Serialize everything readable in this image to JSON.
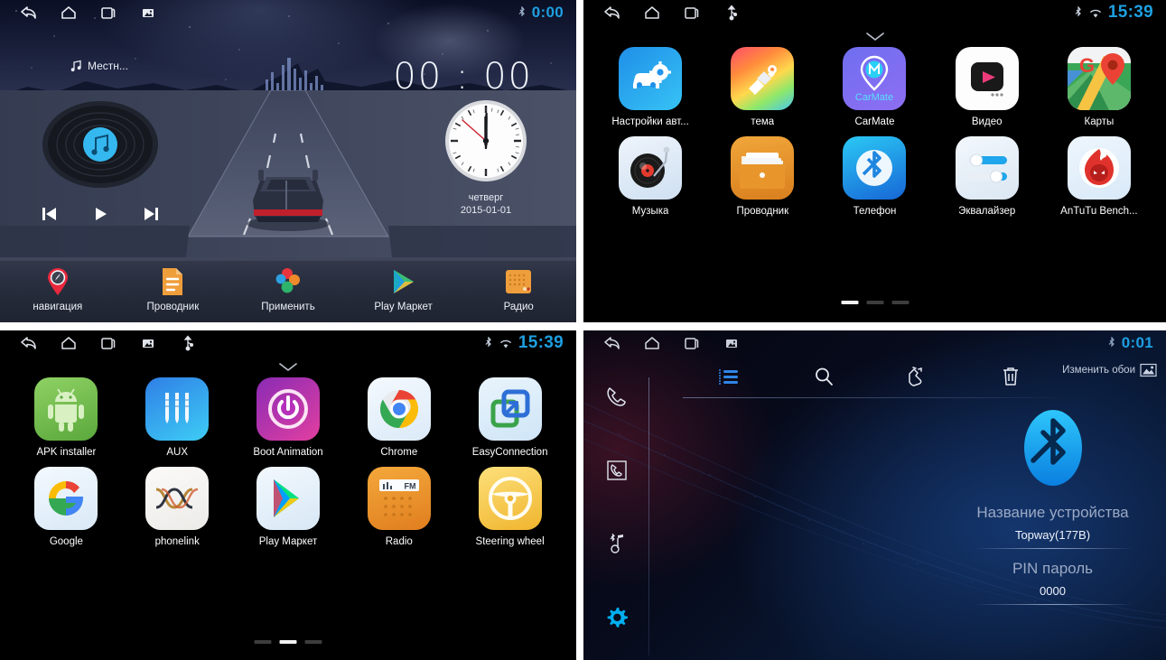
{
  "panels": {
    "home": {
      "statusbar": {
        "nav_icons": [
          "back-icon",
          "home-icon",
          "recents-icon",
          "screenshot-icon"
        ],
        "bluetooth_icon": "bluetooth-icon",
        "time": "0:00"
      },
      "now_playing": {
        "icon": "music-note-icon",
        "label": "Местн..."
      },
      "big_clock": "00 : 00",
      "media_controls": [
        "previous-track-icon",
        "play-icon",
        "next-track-icon"
      ],
      "analog_clock": {
        "day": "четверг",
        "date": "2015-01-01"
      },
      "dock": [
        {
          "label": "навигация",
          "icon": "navigation-pin-icon"
        },
        {
          "label": "Проводник",
          "icon": "file-manager-icon"
        },
        {
          "label": "Применить",
          "icon": "apply-flower-icon"
        },
        {
          "label": "Play Маркет",
          "icon": "play-store-icon"
        },
        {
          "label": "Радио",
          "icon": "radio-icon"
        }
      ]
    },
    "drawer_page1": {
      "statusbar": {
        "nav_icons": [
          "back-icon",
          "home-icon",
          "recents-icon",
          "usb-icon"
        ],
        "bluetooth_icon": "bluetooth-icon",
        "wifi_icon": "wifi-icon",
        "time": "15:39"
      },
      "pull_handle": "chevron-down-icon",
      "apps": [
        {
          "label": "Настройки авт...",
          "icon": "car-settings-icon"
        },
        {
          "label": "тема",
          "icon": "theme-brush-icon"
        },
        {
          "label": "CarMate",
          "icon": "carmate-icon"
        },
        {
          "label": "Видео",
          "icon": "video-player-icon"
        },
        {
          "label": "Карты",
          "icon": "google-maps-icon"
        },
        {
          "label": "Музыка",
          "icon": "music-turntable-icon"
        },
        {
          "label": "Проводник",
          "icon": "file-explorer-icon"
        },
        {
          "label": "Телефон",
          "icon": "bluetooth-phone-icon"
        },
        {
          "label": "Эквалайзер",
          "icon": "equalizer-icon"
        },
        {
          "label": "AnTuTu Bench...",
          "icon": "antutu-icon"
        }
      ],
      "page_dots": {
        "count": 3,
        "active": 0
      }
    },
    "drawer_page2": {
      "statusbar": {
        "nav_icons": [
          "back-icon",
          "home-icon",
          "recents-icon",
          "screenshot-icon",
          "usb-icon"
        ],
        "bluetooth_icon": "bluetooth-icon",
        "wifi_icon": "wifi-icon",
        "time": "15:39"
      },
      "pull_handle": "chevron-down-icon",
      "apps": [
        {
          "label": "APK installer",
          "icon": "android-icon"
        },
        {
          "label": "AUX",
          "icon": "aux-jack-icon"
        },
        {
          "label": "Boot Animation",
          "icon": "power-boot-icon"
        },
        {
          "label": "Chrome",
          "icon": "chrome-icon"
        },
        {
          "label": "EasyConnection",
          "icon": "easyconnection-icon"
        },
        {
          "label": "Google",
          "icon": "google-g-icon"
        },
        {
          "label": "phonelink",
          "icon": "phonelink-icon"
        },
        {
          "label": "Play Маркет",
          "icon": "play-store-icon"
        },
        {
          "label": "Radio",
          "icon": "fm-radio-icon"
        },
        {
          "label": "Steering wheel",
          "icon": "steering-wheel-icon"
        }
      ],
      "page_dots": {
        "count": 3,
        "active": 1
      }
    },
    "bluetooth": {
      "statusbar": {
        "nav_icons": [
          "back-icon",
          "home-icon",
          "recents-icon",
          "screenshot-icon"
        ],
        "bluetooth_icon": "bluetooth-icon",
        "time": "0:01"
      },
      "toolbar": [
        {
          "name": "list-icon",
          "active": true
        },
        {
          "name": "search-icon",
          "active": false
        },
        {
          "name": "pair-hand-icon",
          "active": false
        },
        {
          "name": "trash-icon",
          "active": false
        }
      ],
      "sidebar": [
        {
          "name": "dialer-phone-icon",
          "active": false
        },
        {
          "name": "contacts-icon",
          "active": false
        },
        {
          "name": "bluetooth-music-icon",
          "active": false
        },
        {
          "name": "settings-gear-icon",
          "active": true
        }
      ],
      "change_wallpaper": {
        "label": "Изменить обои",
        "icon": "wallpaper-icon"
      },
      "logo": "bluetooth-logo-icon",
      "device_name": {
        "label": "Название устройства",
        "value": "Topway(177B)"
      },
      "pin": {
        "label": "PIN пароль",
        "value": "0000"
      }
    }
  },
  "colors": {
    "accent_cyan": "#1e9fe0",
    "status_time": "#1e9fe0",
    "bt_blue": "#1da8ef",
    "gear_active": "#00aeef"
  }
}
